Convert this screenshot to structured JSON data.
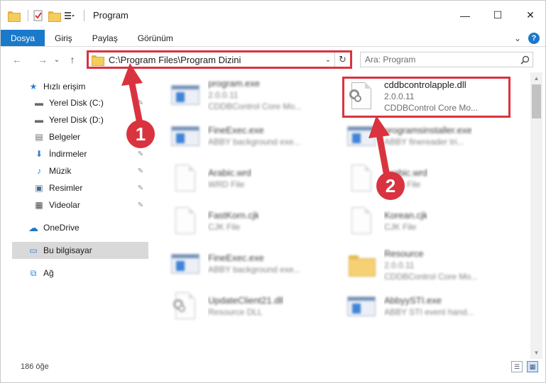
{
  "window": {
    "title": "Program",
    "minimize": "—",
    "maximize": "☐",
    "close": "✕"
  },
  "ribbon": {
    "tabs": [
      "Dosya",
      "Giriş",
      "Paylaş",
      "Görünüm"
    ],
    "expand": "⌄",
    "help": "?"
  },
  "nav": {
    "back": "←",
    "forward": "→",
    "recent": "⌄",
    "up": "↑",
    "address": "C:\\Program Files\\Program Dizini",
    "address_dropdown": "⌄",
    "refresh": "↻",
    "search_placeholder": "Ara: Program",
    "search_icon": "⚲"
  },
  "sidebar": {
    "items": [
      {
        "label": "Hızlı erişim",
        "icon": "★",
        "pinned": false
      },
      {
        "label": "Yerel Disk (C:)",
        "icon": "▬",
        "pinned": true
      },
      {
        "label": "Yerel Disk (D:)",
        "icon": "▬",
        "pinned": true
      },
      {
        "label": "Belgeler",
        "icon": "▤",
        "pinned": true
      },
      {
        "label": "İndirmeler",
        "icon": "⬇",
        "pinned": true
      },
      {
        "label": "Müzik",
        "icon": "♪",
        "pinned": true
      },
      {
        "label": "Resimler",
        "icon": "▣",
        "pinned": true
      },
      {
        "label": "Videolar",
        "icon": "▦",
        "pinned": true
      },
      {
        "label": "OneDrive",
        "icon": "☁",
        "pinned": false
      },
      {
        "label": "Bu bilgisayar",
        "icon": "▭",
        "pinned": false
      },
      {
        "label": "Ağ",
        "icon": "⧉",
        "pinned": false
      }
    ],
    "pin_glyph": "✎"
  },
  "files": [
    {
      "name": "program.exe",
      "line2": "2.0.0.11",
      "line3": "CDDBControl Core Mo...",
      "type": "app",
      "blurred": true
    },
    {
      "name": "cddbcontrolapple.dll",
      "line2": "2.0.0.11",
      "line3": "CDDBControl Core Mo...",
      "type": "gear",
      "blurred": false
    },
    {
      "name": "FineExec.exe",
      "line2": "ABBY background exe...",
      "line3": "",
      "type": "app",
      "blurred": true
    },
    {
      "name": "programsinstaller.exe",
      "line2": "ABBY finereader tri...",
      "line3": "",
      "type": "app",
      "blurred": true
    },
    {
      "name": "Arabic.wrd",
      "line2": "WRD File",
      "line3": "",
      "type": "doc",
      "blurred": true
    },
    {
      "name": "Arabic.wrd",
      "line2": "WRD File",
      "line3": "",
      "type": "doc",
      "blurred": true
    },
    {
      "name": "FastKorn.cjk",
      "line2": "CJK File",
      "line3": "",
      "type": "doc",
      "blurred": true
    },
    {
      "name": "Korean.cjk",
      "line2": "CJK File",
      "line3": "",
      "type": "doc",
      "blurred": true
    },
    {
      "name": "FineExec.exe",
      "line2": "ABBY background exe...",
      "line3": "",
      "type": "app",
      "blurred": true
    },
    {
      "name": "Resource",
      "line2": "2.0.0.11",
      "line3": "CDDBControl Core Mo...",
      "type": "folder",
      "blurred": true
    },
    {
      "name": "UpdateClient21.dll",
      "line2": "Resource DLL",
      "line3": "",
      "type": "gear",
      "blurred": true
    },
    {
      "name": "AbbyySTI.exe",
      "line2": "ABBY STI event hand...",
      "line3": "",
      "type": "app",
      "blurred": true
    }
  ],
  "status": {
    "count": "186 öğe"
  },
  "annotations": {
    "badge1": "1",
    "badge2": "2",
    "color": "#d9333f"
  }
}
